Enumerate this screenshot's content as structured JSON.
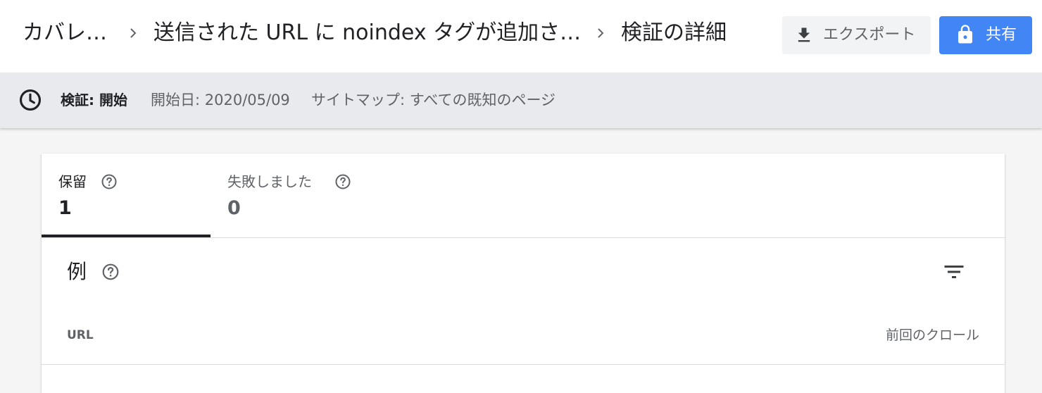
{
  "breadcrumb": {
    "items": [
      "カバレ…",
      "送信された URL に noindex タグが追加さ…",
      "検証の詳細"
    ]
  },
  "toolbar": {
    "export_label": "エクスポート",
    "share_label": "共有"
  },
  "status": {
    "validation_label": "検証: 開始",
    "start_date": "開始日: 2020/05/09",
    "sitemap": "サイトマップ: すべての既知のページ"
  },
  "tabs": [
    {
      "label": "保留",
      "count": "1",
      "active": true
    },
    {
      "label": "失敗しました",
      "count": "0",
      "active": false
    }
  ],
  "examples": {
    "title": "例",
    "columns": {
      "url": "URL",
      "last_crawl": "前回のクロール"
    }
  },
  "colors": {
    "accent": "#4285f4",
    "text_primary": "#202124",
    "text_secondary": "#5f6368",
    "status_bg": "#e8eaed"
  },
  "icons": {
    "separator": "chevron-right-icon",
    "export": "download-icon",
    "share": "lock-icon",
    "status": "clock-icon",
    "help": "help-circle-icon",
    "filter": "filter-icon"
  }
}
